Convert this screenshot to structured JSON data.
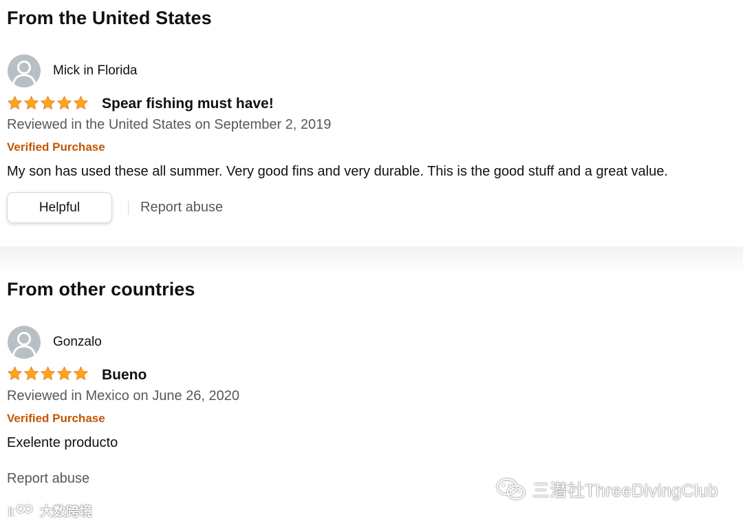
{
  "colors": {
    "star": "#ffa41c",
    "verified": "#c45500",
    "secondary_text": "#565959",
    "avatar_bg": "#b9c0c4"
  },
  "sections": [
    {
      "title": "From the United States",
      "review": {
        "reviewer": "Mick in Florida",
        "rating": 5,
        "title": "Spear fishing must have!",
        "meta": "Reviewed in the United States on September 2, 2019",
        "verified": "Verified Purchase",
        "body": "My son has used these all summer. Very good fins and very durable. This is the good stuff and a great value.",
        "helpful_label": "Helpful",
        "report_label": "Report abuse"
      }
    },
    {
      "title": "From other countries",
      "review": {
        "reviewer": "Gonzalo",
        "rating": 5,
        "title": "Bueno",
        "meta": "Reviewed in Mexico on June 26, 2020",
        "verified": "Verified Purchase",
        "body": "Exelente producto",
        "report_label": "Report abuse"
      }
    }
  ],
  "watermarks": {
    "right": "三潜社ThreeDivingClub",
    "left": "大数跨境"
  }
}
